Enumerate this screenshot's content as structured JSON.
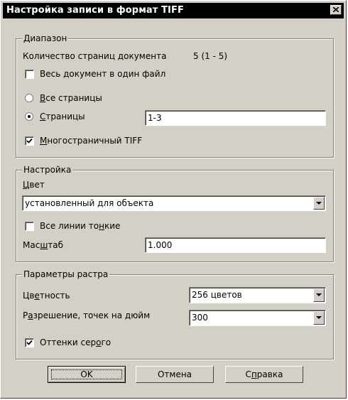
{
  "dialog": {
    "title": "Настройка записи в формат TIFF"
  },
  "range": {
    "legend": "Диапазон",
    "page_count_label": "Количество страниц документа",
    "page_count_value": "5 (1 - 5)",
    "whole_doc_label": "Весь документ в один файл",
    "all_pages_label": "Все страницы",
    "pages_label": "Страницы",
    "pages_value": "1-3",
    "multipage_label": "Многостраничный TIFF"
  },
  "settings": {
    "legend": "Настройка",
    "color_label": "Цвет",
    "color_value": "установленный для объекта",
    "thin_lines_label": "Все линии тонкие",
    "scale_label": "Масштаб",
    "scale_value": "1.000"
  },
  "raster": {
    "legend": "Параметры растра",
    "color_depth_label": "Цветность",
    "color_depth_value": "256 цветов",
    "resolution_label": "Разрешение, точек на дюйм",
    "resolution_value": "300",
    "grayscale_label": "Оттенки серого"
  },
  "buttons": {
    "ok": "OK",
    "cancel": "Отмена",
    "help": "Справка"
  },
  "state": {
    "whole_doc_checked": false,
    "all_pages_selected": false,
    "pages_selected": true,
    "multipage_checked": true,
    "thin_lines_checked": false,
    "grayscale_checked": true
  }
}
